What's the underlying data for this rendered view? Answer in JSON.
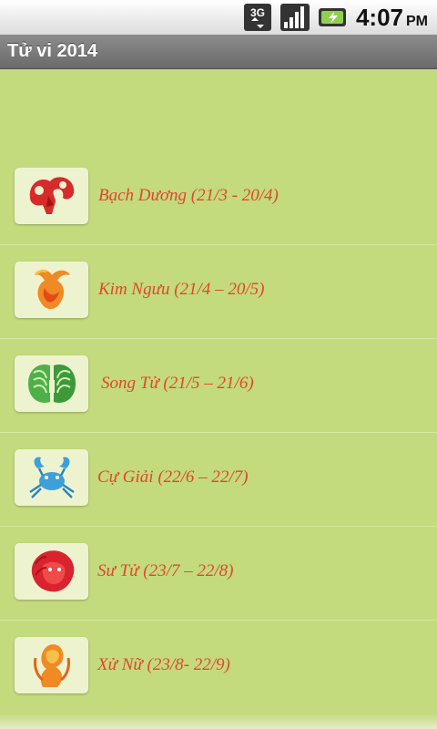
{
  "status_bar": {
    "network_label": "3G",
    "network_icon": "3g-data-icon",
    "signal_icon": "signal-bars-icon",
    "battery_icon": "battery-charging-icon",
    "time": "4:07",
    "ampm": "PM"
  },
  "title_bar": {
    "title": "Tử vi 2014"
  },
  "colors": {
    "background": "#c3da7d",
    "label": "#e0472d",
    "thumb_bg": "#eef3cf",
    "title_bar": "#7a7a7a"
  },
  "zodiac": [
    {
      "label": "Bạch Dương (21/3 - 20/4)",
      "icon": "aries-icon"
    },
    {
      "label": "Kim Ngưu (21/4 – 20/5)",
      "icon": "taurus-icon"
    },
    {
      "label": "Song Tử (21/5 – 21/6)",
      "icon": "gemini-icon"
    },
    {
      "label": "Cự Giải (22/6 – 22/7)",
      "icon": "cancer-icon"
    },
    {
      "label": "Sư Tử (23/7 – 22/8)",
      "icon": "leo-icon"
    },
    {
      "label": "Xử Nữ (23/8- 22/9)",
      "icon": "virgo-icon"
    }
  ]
}
